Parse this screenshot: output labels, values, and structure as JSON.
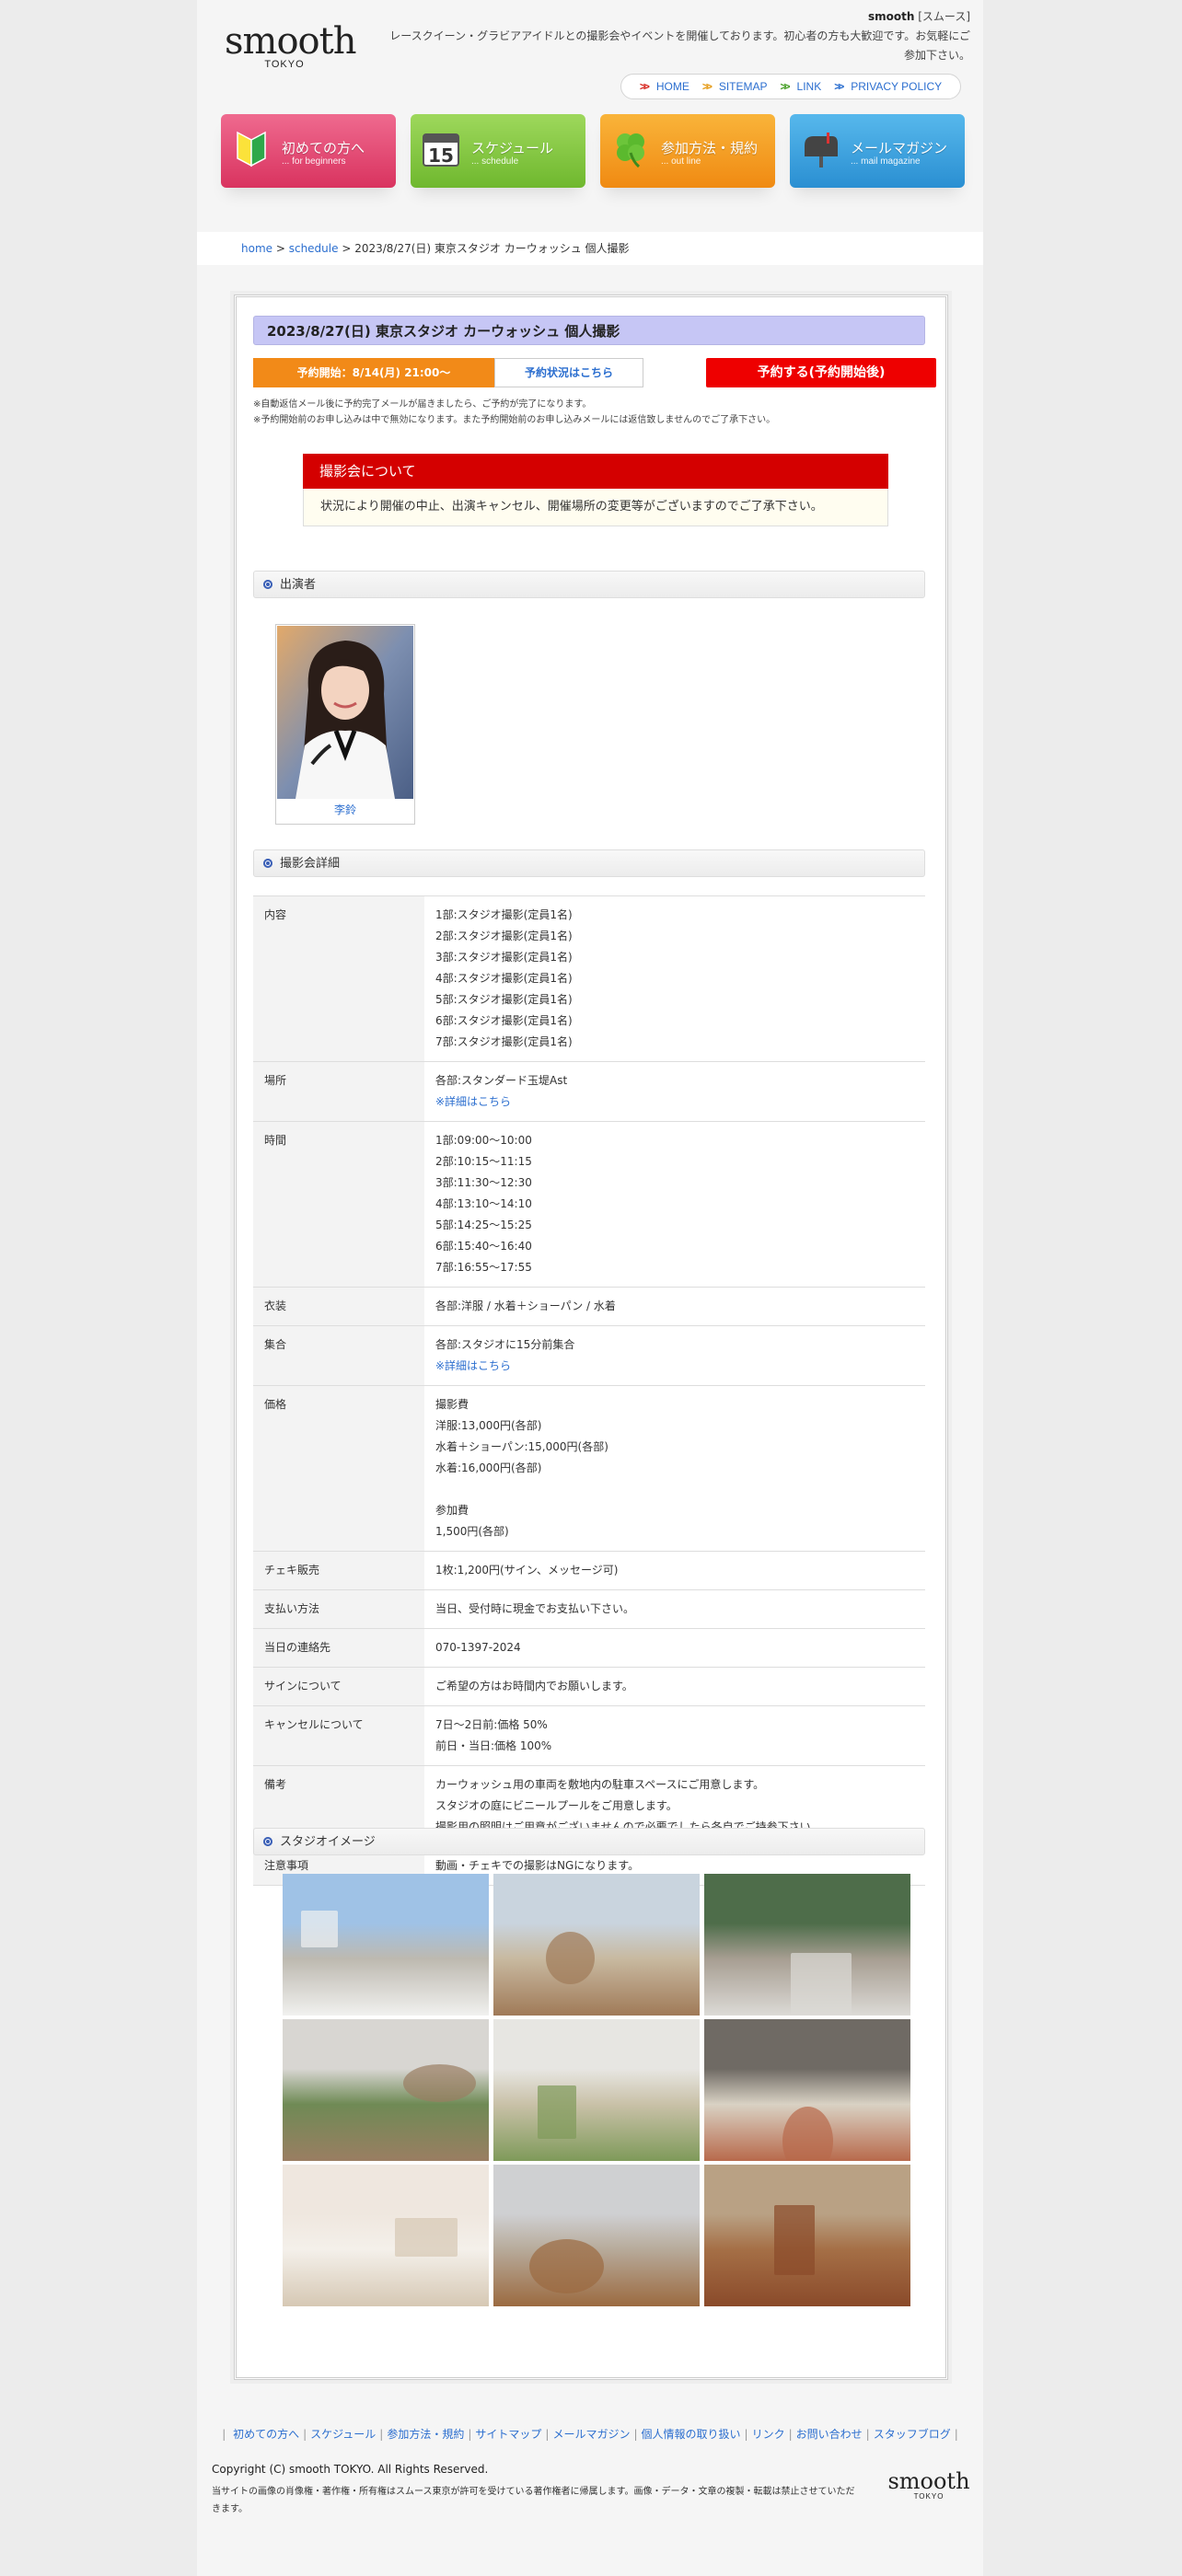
{
  "logo": {
    "name": "smooth",
    "sub": "TOKYO"
  },
  "intro": {
    "brand": "smooth",
    "brand_kana": "[スムース]",
    "text": "レースクイーン・グラビアアイドルとの撮影会やイベントを開催しております。初心者の方も大歓迎です。お気軽にご参加下さい。"
  },
  "topnav": [
    "HOME",
    "SITEMAP",
    "LINK",
    "PRIVACY POLICY"
  ],
  "bigbuttons": [
    {
      "title": "初めての方へ",
      "sub": "... for beginners",
      "icon": "beginner-mark-icon"
    },
    {
      "title": "スケジュール",
      "sub": "... schedule",
      "icon": "calendar-icon"
    },
    {
      "title": "参加方法・規約",
      "sub": "... out line",
      "icon": "clover-icon"
    },
    {
      "title": "メールマガジン",
      "sub": "... mail magazine",
      "icon": "mailbox-icon"
    }
  ],
  "breadcrumb": {
    "home": "home",
    "schedule": "schedule",
    "sep": " > ",
    "current": "2023/8/27(日) 東京スタジオ カーウォッシュ 個人撮影"
  },
  "event": {
    "title": "2023/8/27(日) 東京スタジオ カーウォッシュ 個人撮影",
    "open": "予約開始：8/14(月) 21:00〜",
    "status_link": "予約状況はこちら",
    "reserve": "予約する(予約開始後)",
    "note1": "※自動返信メール後に予約完了メールが届きましたら、ご予約が完了になります。",
    "note2": "※予約開始前のお申し込みは中で無効になります。また予約開始前のお申し込みメールには返信致しませんのでご了承下さい。"
  },
  "notice": {
    "head": "撮影会について",
    "body": "状況により開催の中止、出演キャンセル、開催場所の変更等がございますのでご了承下さい。"
  },
  "sections": {
    "performers": "出演者",
    "details": "撮影会詳細",
    "studio": "スタジオイメージ"
  },
  "performer": {
    "name": "李鈴"
  },
  "details": [
    {
      "k": "内容",
      "v": [
        "1部:スタジオ撮影(定員1名)",
        "2部:スタジオ撮影(定員1名)",
        "3部:スタジオ撮影(定員1名)",
        "4部:スタジオ撮影(定員1名)",
        "5部:スタジオ撮影(定員1名)",
        "6部:スタジオ撮影(定員1名)",
        "7部:スタジオ撮影(定員1名)"
      ]
    },
    {
      "k": "場所",
      "v": [
        "各部:スタンダード玉堤Ast"
      ],
      "link": "※詳細はこちら"
    },
    {
      "k": "時間",
      "v": [
        "1部:09:00〜10:00",
        "2部:10:15〜11:15",
        "3部:11:30〜12:30",
        "4部:13:10〜14:10",
        "5部:14:25〜15:25",
        "6部:15:40〜16:40",
        "7部:16:55〜17:55"
      ]
    },
    {
      "k": "衣装",
      "v": [
        "各部:洋服 / 水着＋ショーパン / 水着"
      ]
    },
    {
      "k": "集合",
      "v": [
        "各部:スタジオに15分前集合"
      ],
      "link": "※詳細はこちら"
    },
    {
      "k": "価格",
      "v": [
        "撮影費",
        "洋服:13,000円(各部)",
        "水着＋ショーパン:15,000円(各部)",
        "水着:16,000円(各部)",
        "",
        "参加費",
        "1,500円(各部)"
      ]
    },
    {
      "k": "チェキ販売",
      "v": [
        "1枚:1,200円(サイン、メッセージ可)"
      ]
    },
    {
      "k": "支払い方法",
      "v": [
        "当日、受付時に現金でお支払い下さい。"
      ]
    },
    {
      "k": "当日の連絡先",
      "v": [
        "070-1397-2024"
      ]
    },
    {
      "k": "サインについて",
      "v": [
        "ご希望の方はお時間内でお願いします。"
      ]
    },
    {
      "k": "キャンセルについて",
      "v": [
        "7日〜2日前:価格 50%",
        "前日・当日:価格 100%"
      ]
    },
    {
      "k": "備考",
      "v": [
        "カーウォッシュ用の車両を敷地内の駐車スペースにご用意します。",
        "スタジオの庭にビニールプールをご用意します。",
        "撮影用の照明はご用意がございませんので必要でしたら各自でご持参下さい。"
      ]
    },
    {
      "k": "注意事項",
      "v": [
        "動画・チェキでの撮影はNGになります。"
      ]
    }
  ],
  "gallery_colors": [
    [
      "#9fc2e6",
      "#f1f1ef",
      "#bdb9b0"
    ],
    [
      "#c9d4de",
      "#a07a58",
      "#c8b9a0"
    ],
    [
      "#4e6d4a",
      "#dcdad6",
      "#a79e92"
    ],
    [
      "#d8d6d2",
      "#9a7e62",
      "#6f8a55"
    ],
    [
      "#e7e6e2",
      "#7f9a5a",
      "#c9c1a8"
    ],
    [
      "#6f6a64",
      "#b86a4c",
      "#d9d2c4"
    ],
    [
      "#efe7df",
      "#d6c8b4",
      "#f4f0ea"
    ],
    [
      "#cfd0d2",
      "#9b6a40",
      "#b7aa9a"
    ],
    [
      "#b9a184",
      "#8a4a2a",
      "#a56f46"
    ]
  ],
  "footer": {
    "links": [
      "初めての方へ",
      "スケジュール",
      "参加方法・規約",
      "サイトマップ",
      "メールマガジン",
      "個人情報の取り扱い",
      "リンク",
      "お問い合わせ",
      "スタッフブログ"
    ],
    "copyright": "Copyright (C) smooth TOKYO. All Rights Reserved.",
    "legal": "当サイトの画像の肖像権・著作権・所有権はスムース東京が許可を受けている著作権者に帰属します。画像・データ・文章の複製・転載は禁止させていただきます。",
    "logo": "smooth",
    "logo_sub": "TOKYO"
  }
}
